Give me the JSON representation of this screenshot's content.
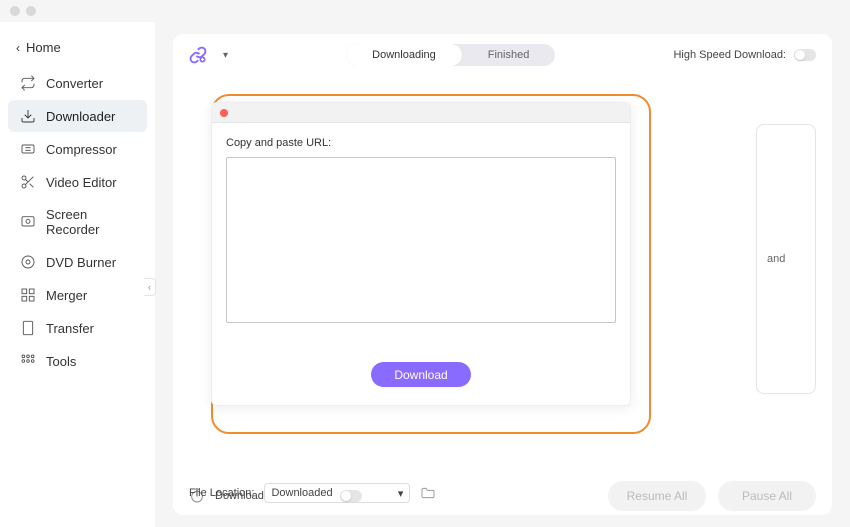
{
  "home_label": "Home",
  "sidebar": [
    {
      "label": "Converter"
    },
    {
      "label": "Downloader"
    },
    {
      "label": "Compressor"
    },
    {
      "label": "Video Editor"
    },
    {
      "label": "Screen Recorder"
    },
    {
      "label": "DVD Burner"
    },
    {
      "label": "Merger"
    },
    {
      "label": "Transfer"
    },
    {
      "label": "Tools"
    }
  ],
  "tabs": {
    "downloading": "Downloading",
    "finished": "Finished"
  },
  "high_speed_label": "High Speed Download:",
  "behind_text": "and",
  "modal": {
    "prompt": "Copy and paste URL:",
    "download_btn": "Download"
  },
  "footer": {
    "download_then_convert": "Download then Convert",
    "file_location_label": "File Location:",
    "location_value": "Downloaded",
    "resume": "Resume All",
    "pause": "Pause All"
  }
}
